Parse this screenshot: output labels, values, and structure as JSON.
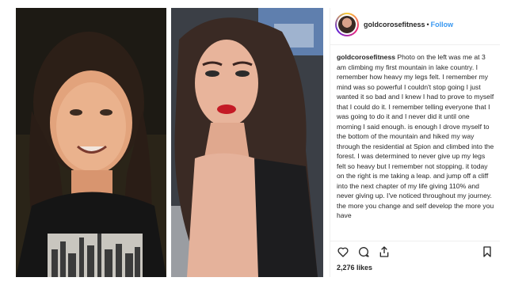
{
  "post": {
    "username": "goldcorosefitness",
    "dot": "•",
    "follow_label": "Follow",
    "caption_username": "goldcorosefitness",
    "caption_text": "Photo on the left was me at 3 am climbing my first mountain in lake country. I remember how heavy my legs felt. I remember my mind was so powerful I couldn't stop going I just wanted it so bad and I knew I had to prove to myself that I could do it. I remember telling everyone that I was going to do it and I never did it until one morning I said enough. is enough I drove myself to the bottom of the mountain and hiked my way through the residential at Spion and climbed into the forest. I was determined to never give up my legs felt so heavy but I remember not stopping. it today on the right is me taking a leap. and jump off a cliff into the next chapter of my life giving 110% and never giving up. I've noticed throughout my journey. the more you change and self develop the more you have",
    "likes": "2,276 likes"
  },
  "icons": {
    "like": "heart-icon",
    "comment": "comment-icon",
    "share": "share-icon",
    "save": "bookmark-icon"
  },
  "colors": {
    "link": "#3897f0",
    "text": "#262626",
    "divider": "#efefef"
  }
}
